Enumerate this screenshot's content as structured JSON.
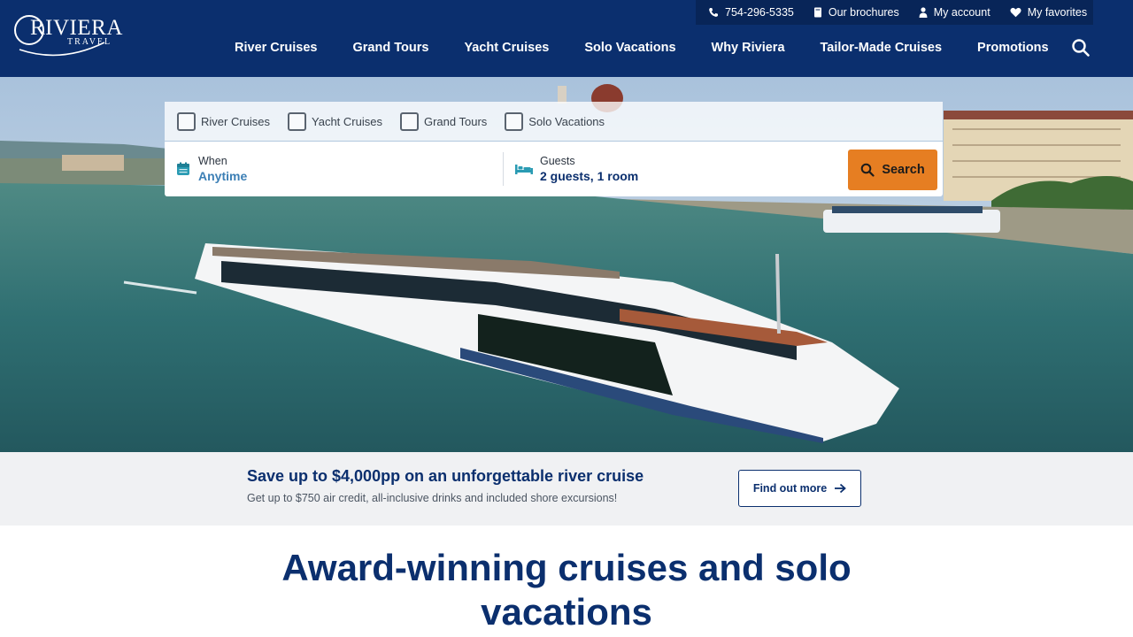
{
  "brand": {
    "logo_text": "RIVIERA",
    "logo_sub": "TRAVEL",
    "primary_color": "#0b2f6e",
    "accent_color": "#e67e22"
  },
  "utility_bar": {
    "phone": "754-296-5335",
    "brochures": "Our brochures",
    "account": "My account",
    "favorites": "My favorites"
  },
  "nav": {
    "items": [
      {
        "label": "River Cruises"
      },
      {
        "label": "Grand Tours"
      },
      {
        "label": "Yacht Cruises"
      },
      {
        "label": "Solo Vacations"
      },
      {
        "label": "Why Riviera"
      },
      {
        "label": "Tailor-Made Cruises"
      },
      {
        "label": "Promotions"
      }
    ],
    "search_icon": "search-icon"
  },
  "search": {
    "types": [
      {
        "label": "River Cruises",
        "checked": false
      },
      {
        "label": "Yacht Cruises",
        "checked": false
      },
      {
        "label": "Grand Tours",
        "checked": false
      },
      {
        "label": "Solo Vacations",
        "checked": false
      }
    ],
    "when_label": "When",
    "when_value": "Anytime",
    "guests_label": "Guests",
    "guests_value": "2 guests, 1 room",
    "button_label": "Search"
  },
  "promo": {
    "title": "Save up to $4,000pp on an unforgettable river cruise",
    "subtitle": "Get up to $750 air credit, all-inclusive drinks and included shore excursions!",
    "button_label": "Find out more"
  },
  "headline": {
    "line1": "Award-winning cruises and solo",
    "line2": "vacations"
  }
}
